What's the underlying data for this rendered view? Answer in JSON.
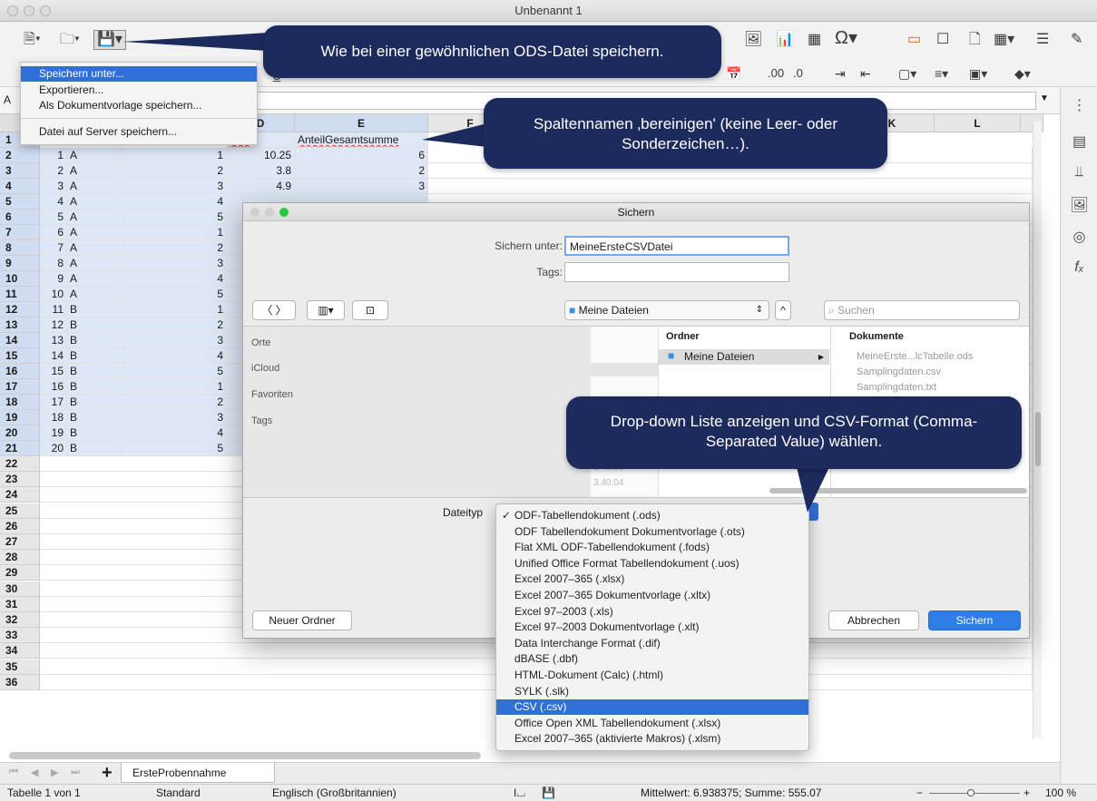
{
  "window": {
    "title": "Unbenannt 1"
  },
  "menu": {
    "items": [
      "Speichern unter...",
      "Exportieren...",
      "Als Dokumentvorlage speichern...",
      "Datei auf Server speichern..."
    ]
  },
  "callouts": {
    "save": "Wie bei einer gewöhnlichen ODS-Datei speichern.",
    "columns": "Spaltennamen ‚bereinigen' (keine Leer- oder Sonderzeichen…).",
    "dropdown": "Drop-down Liste anzeigen und CSV-Format (Comma-Separated Value) wählen."
  },
  "grid": {
    "columns": [
      "D",
      "E",
      "F",
      "K",
      "L"
    ],
    "header_row": {
      "c": "wert",
      "d": "AnteilGesamtsumme"
    },
    "rows": [
      {
        "n": "2",
        "a": "1",
        "b": "A",
        "c": "1",
        "d": "10.25",
        "e": "6"
      },
      {
        "n": "3",
        "a": "2",
        "b": "A",
        "c": "2",
        "d": "3.8",
        "e": "2"
      },
      {
        "n": "4",
        "a": "3",
        "b": "A",
        "c": "3",
        "d": "4.9",
        "e": "3"
      },
      {
        "n": "5",
        "a": "4",
        "b": "A",
        "c": "4",
        "d": "",
        "e": ""
      },
      {
        "n": "6",
        "a": "5",
        "b": "A",
        "c": "5",
        "d": "",
        "e": ""
      },
      {
        "n": "7",
        "a": "6",
        "b": "A",
        "c": "1",
        "d": "",
        "e": ""
      },
      {
        "n": "8",
        "a": "7",
        "b": "A",
        "c": "2",
        "d": "",
        "e": ""
      },
      {
        "n": "9",
        "a": "8",
        "b": "A",
        "c": "3",
        "d": "",
        "e": ""
      },
      {
        "n": "10",
        "a": "9",
        "b": "A",
        "c": "4",
        "d": "",
        "e": ""
      },
      {
        "n": "11",
        "a": "10",
        "b": "A",
        "c": "5",
        "d": "",
        "e": ""
      },
      {
        "n": "12",
        "a": "11",
        "b": "B",
        "c": "1",
        "d": "",
        "e": ""
      },
      {
        "n": "13",
        "a": "12",
        "b": "B",
        "c": "2",
        "d": "",
        "e": ""
      },
      {
        "n": "14",
        "a": "13",
        "b": "B",
        "c": "3",
        "d": "",
        "e": ""
      },
      {
        "n": "15",
        "a": "14",
        "b": "B",
        "c": "4",
        "d": "",
        "e": ""
      },
      {
        "n": "16",
        "a": "15",
        "b": "B",
        "c": "5",
        "d": "",
        "e": ""
      },
      {
        "n": "17",
        "a": "16",
        "b": "B",
        "c": "1",
        "d": "",
        "e": ""
      },
      {
        "n": "18",
        "a": "17",
        "b": "B",
        "c": "2",
        "d": "",
        "e": ""
      },
      {
        "n": "19",
        "a": "18",
        "b": "B",
        "c": "3",
        "d": "",
        "e": ""
      },
      {
        "n": "20",
        "a": "19",
        "b": "B",
        "c": "4",
        "d": "",
        "e": ""
      },
      {
        "n": "21",
        "a": "20",
        "b": "B",
        "c": "5",
        "d": "",
        "e": ""
      }
    ],
    "empty_rows": [
      "22",
      "23",
      "24",
      "25",
      "26",
      "27",
      "28",
      "29",
      "30",
      "31",
      "32",
      "33",
      "34",
      "35",
      "36"
    ]
  },
  "dialog": {
    "title": "Sichern",
    "save_as_label": "Sichern unter:",
    "filename": "MeineErsteCSVDatei",
    "tags_label": "Tags:",
    "location": "Meine Dateien",
    "search_placeholder": "Suchen",
    "sidebar": [
      "Orte",
      "iCloud",
      "Favoriten",
      "Tags"
    ],
    "col_ordner": "Ordner",
    "col_dokumente": "Dokumente",
    "folder_item": "Meine Dateien",
    "documents": [
      "MeineErste...lcTabelle.ods",
      "Samplingdaten.csv",
      "Samplingdaten.txt"
    ],
    "preview_rows": [
      "3.48.56",
      "3.40.04"
    ],
    "filetype_label": "Dateityp",
    "new_folder": "Neuer Ordner",
    "cancel": "Abbrechen",
    "save": "Sichern"
  },
  "dropdown": {
    "options": [
      "ODF-Tabellendokument (.ods)",
      "ODF Tabellendokument Dokumentvorlage (.ots)",
      "Flat XML ODF-Tabellendokument (.fods)",
      "Unified Office Format Tabellendokument (.uos)",
      "Excel 2007–365 (.xlsx)",
      "Excel 2007–365 Dokumentvorlage (.xltx)",
      "Excel 97–2003 (.xls)",
      "Excel 97–2003 Dokumentvorlage (.xlt)",
      "Data Interchange Format (.dif)",
      "dBASE (.dbf)",
      "HTML-Dokument (Calc) (.html)",
      "SYLK (.slk)",
      "CSV (.csv)",
      "Office Open XML Tabellendokument (.xlsx)",
      "Excel 2007–365 (aktivierte Makros) (.xlsm)"
    ],
    "checked_index": 0,
    "highlighted_index": 12
  },
  "tabs": {
    "sheet": "ErsteProbennahme"
  },
  "status": {
    "sheet": "Tabelle 1 von 1",
    "style": "Standard",
    "language": "Englisch (Großbritannien)",
    "summary": "Mittelwert: 6.938375; Summe: 555.07",
    "zoom": "100 %"
  },
  "colors": {
    "accent": "#2f6fd6",
    "callout": "#1d2a5c"
  }
}
